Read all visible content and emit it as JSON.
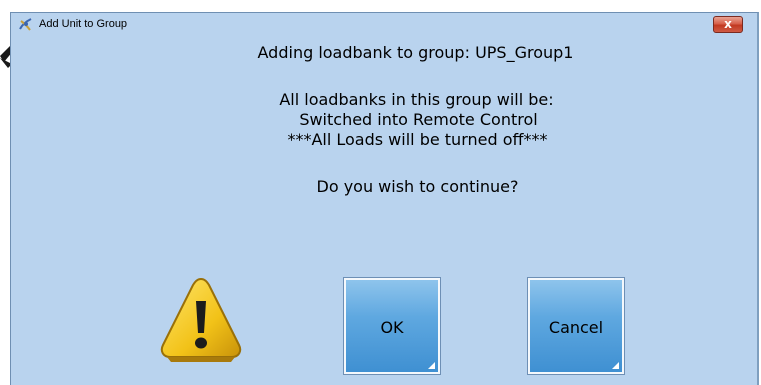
{
  "window": {
    "title": "Add Unit to Group",
    "close_glyph": "x"
  },
  "message": {
    "heading": "Adding loadbank to group: UPS_Group1",
    "line1": "All loadbanks in this group will be:",
    "line2": "Switched into Remote Control",
    "line3": "***All Loads will be turned off***",
    "question": "Do you wish to continue?"
  },
  "buttons": {
    "ok_label": "OK",
    "cancel_label": "Cancel"
  },
  "icons": {
    "app": "app-icon",
    "warning": "warning-icon",
    "close": "close-icon",
    "pointer": "arrow-pointer-icon"
  },
  "colors": {
    "background": "#b9d3ee",
    "button": "#4f9bd8",
    "close": "#c94a32",
    "warning": "#f3c419"
  }
}
